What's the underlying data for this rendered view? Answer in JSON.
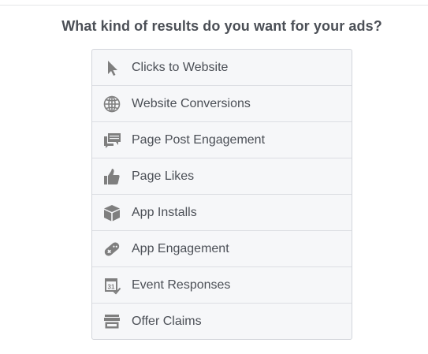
{
  "heading": "What kind of results do you want for your ads?",
  "options": [
    {
      "label": "Clicks to Website",
      "icon": "cursor-icon"
    },
    {
      "label": "Website Conversions",
      "icon": "globe-icon"
    },
    {
      "label": "Page Post Engagement",
      "icon": "comments-icon"
    },
    {
      "label": "Page Likes",
      "icon": "thumbs-up-icon"
    },
    {
      "label": "App Installs",
      "icon": "box-icon"
    },
    {
      "label": "App Engagement",
      "icon": "gamepad-icon"
    },
    {
      "label": "Event Responses",
      "icon": "calendar-icon"
    },
    {
      "label": "Offer Claims",
      "icon": "storefront-icon"
    }
  ],
  "colors": {
    "icon": "#7f7f7f",
    "text": "#4b4f56",
    "panel_bg": "#f6f7f9",
    "border": "#d3d6db"
  }
}
